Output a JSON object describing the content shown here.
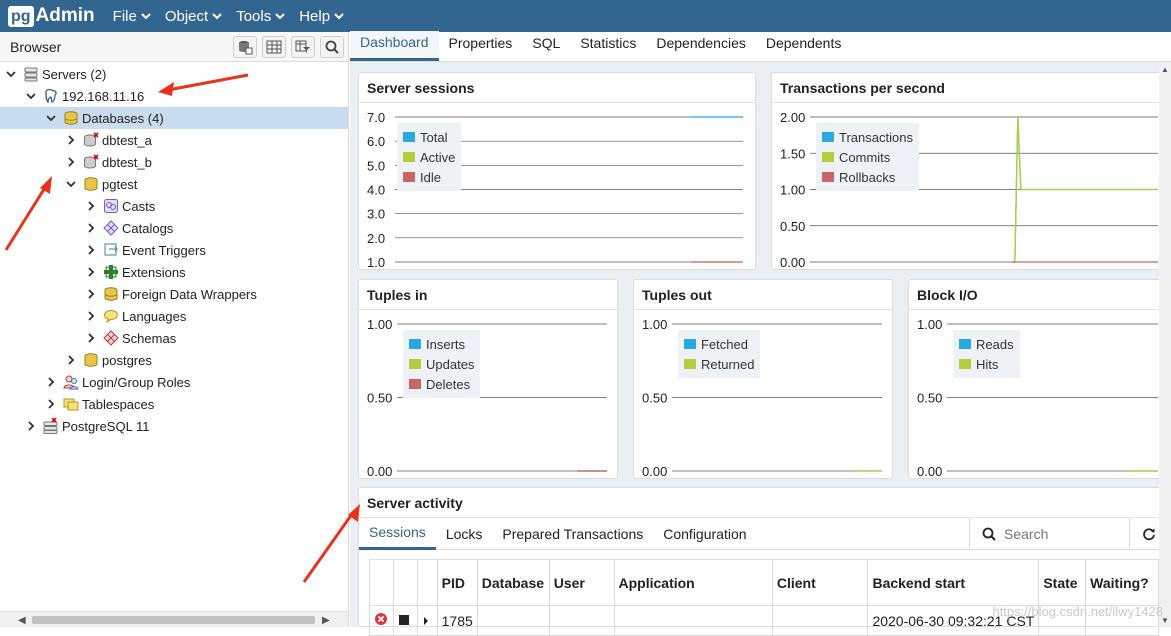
{
  "app": {
    "logo_pg": "pg",
    "logo_admin": "Admin",
    "menu": [
      "File",
      "Object",
      "Tools",
      "Help"
    ]
  },
  "browser": {
    "title": "Browser",
    "tree": [
      {
        "label": "Servers (2)",
        "level": 0,
        "expanded": true,
        "icon": "servers-icon"
      },
      {
        "label": "192.168.11.16",
        "level": 1,
        "expanded": true,
        "icon": "postgres-elephant-icon"
      },
      {
        "label": "Databases (4)",
        "level": 2,
        "expanded": true,
        "icon": "databases-icon",
        "selected": true
      },
      {
        "label": "dbtest_a",
        "level": 3,
        "expanded": false,
        "icon": "database-disconnected-icon"
      },
      {
        "label": "dbtest_b",
        "level": 3,
        "expanded": false,
        "icon": "database-disconnected-icon"
      },
      {
        "label": "pgtest",
        "level": 3,
        "expanded": true,
        "icon": "database-icon"
      },
      {
        "label": "Casts",
        "level": 4,
        "expanded": false,
        "icon": "casts-icon"
      },
      {
        "label": "Catalogs",
        "level": 4,
        "expanded": false,
        "icon": "catalogs-icon"
      },
      {
        "label": "Event Triggers",
        "level": 4,
        "expanded": false,
        "icon": "event-triggers-icon"
      },
      {
        "label": "Extensions",
        "level": 4,
        "expanded": false,
        "icon": "extensions-icon"
      },
      {
        "label": "Foreign Data Wrappers",
        "level": 4,
        "expanded": false,
        "icon": "fdw-icon"
      },
      {
        "label": "Languages",
        "level": 4,
        "expanded": false,
        "icon": "languages-icon"
      },
      {
        "label": "Schemas",
        "level": 4,
        "expanded": false,
        "icon": "schemas-icon"
      },
      {
        "label": "postgres",
        "level": 3,
        "expanded": false,
        "icon": "database-icon"
      },
      {
        "label": "Login/Group Roles",
        "level": 2,
        "expanded": false,
        "icon": "roles-icon"
      },
      {
        "label": "Tablespaces",
        "level": 2,
        "expanded": false,
        "icon": "tablespaces-icon"
      },
      {
        "label": "PostgreSQL 11",
        "level": 1,
        "expanded": false,
        "icon": "server-disconnected-icon"
      }
    ]
  },
  "tabs": [
    "Dashboard",
    "Properties",
    "SQL",
    "Statistics",
    "Dependencies",
    "Dependents"
  ],
  "colors": {
    "blue": "#29a9e0",
    "green": "#b3cd3a",
    "red": "#cc6666",
    "brand": "#326690"
  },
  "chart_data": [
    {
      "type": "line",
      "title": "Server sessions",
      "yticks": [
        "7.0",
        "6.0",
        "5.0",
        "4.0",
        "3.0",
        "2.0",
        "1.0"
      ],
      "ylim": [
        1,
        7
      ],
      "series": [
        {
          "name": "Total",
          "values": [
            7,
            7
          ]
        },
        {
          "name": "Active",
          "values": [
            1,
            1
          ]
        },
        {
          "name": "Idle",
          "values": [
            1,
            1
          ]
        }
      ]
    },
    {
      "type": "line",
      "title": "Transactions per second",
      "yticks": [
        "2.00",
        "1.50",
        "1.00",
        "0.50",
        "0.00"
      ],
      "ylim": [
        0,
        2
      ],
      "series": [
        {
          "name": "Transactions",
          "values": [
            0,
            0,
            2,
            1,
            1,
            1
          ]
        },
        {
          "name": "Commits",
          "values": [
            0,
            0,
            2,
            1,
            1,
            1
          ]
        },
        {
          "name": "Rollbacks",
          "values": [
            0,
            0,
            0,
            0,
            0,
            0
          ]
        }
      ]
    },
    {
      "type": "line",
      "title": "Tuples in",
      "yticks": [
        "1.00",
        "0.50",
        "0.00"
      ],
      "ylim": [
        0,
        1
      ],
      "series": [
        {
          "name": "Inserts",
          "values": [
            0,
            0
          ]
        },
        {
          "name": "Updates",
          "values": [
            0,
            0
          ]
        },
        {
          "name": "Deletes",
          "values": [
            0,
            0
          ]
        }
      ]
    },
    {
      "type": "line",
      "title": "Tuples out",
      "yticks": [
        "1.00",
        "0.50",
        "0.00"
      ],
      "ylim": [
        0,
        1
      ],
      "series": [
        {
          "name": "Fetched",
          "values": [
            0,
            0
          ]
        },
        {
          "name": "Returned",
          "values": [
            0,
            0
          ]
        }
      ]
    },
    {
      "type": "line",
      "title": "Block I/O",
      "yticks": [
        "1.00",
        "0.50",
        "0.00"
      ],
      "ylim": [
        0,
        1
      ],
      "series": [
        {
          "name": "Reads",
          "values": [
            0,
            0
          ]
        },
        {
          "name": "Hits",
          "values": [
            0,
            0
          ]
        }
      ]
    }
  ],
  "activity": {
    "title": "Server activity",
    "tabs": [
      "Sessions",
      "Locks",
      "Prepared Transactions",
      "Configuration"
    ],
    "search_placeholder": "Search",
    "columns": [
      "",
      "",
      "",
      "PID",
      "Database",
      "User",
      "Application",
      "Client",
      "Backend start",
      "State",
      "Waiting?"
    ],
    "rows": [
      [
        "",
        "",
        "",
        "1785",
        "",
        "",
        "",
        "",
        "2020-06-30 09:32:21 CST",
        "",
        ""
      ]
    ]
  },
  "watermark": "https://blog.csdn.net/llwy1428"
}
